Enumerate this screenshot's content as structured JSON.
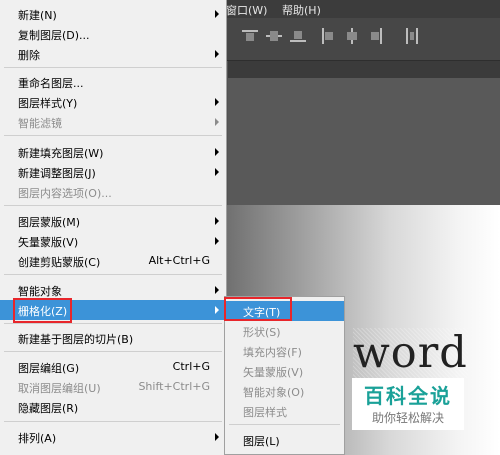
{
  "menubar": {
    "window": "窗口(W)",
    "help": "帮助(H)"
  },
  "menu": {
    "items": [
      {
        "label": "新建(N)",
        "shortcut": "",
        "submenu": true,
        "disabled": false
      },
      {
        "label": "复制图层(D)...",
        "shortcut": "",
        "submenu": false,
        "disabled": false
      },
      {
        "label": "删除",
        "shortcut": "",
        "submenu": true,
        "disabled": false
      },
      {
        "label": "重命名图层...",
        "shortcut": "",
        "submenu": false,
        "disabled": false
      },
      {
        "label": "图层样式(Y)",
        "shortcut": "",
        "submenu": true,
        "disabled": false
      },
      {
        "label": "智能滤镜",
        "shortcut": "",
        "submenu": true,
        "disabled": true
      },
      {
        "label": "新建填充图层(W)",
        "shortcut": "",
        "submenu": true,
        "disabled": false
      },
      {
        "label": "新建调整图层(J)",
        "shortcut": "",
        "submenu": true,
        "disabled": false
      },
      {
        "label": "图层内容选项(O)...",
        "shortcut": "",
        "submenu": false,
        "disabled": true
      },
      {
        "label": "图层蒙版(M)",
        "shortcut": "",
        "submenu": true,
        "disabled": false
      },
      {
        "label": "矢量蒙版(V)",
        "shortcut": "",
        "submenu": true,
        "disabled": false
      },
      {
        "label": "创建剪贴蒙版(C)",
        "shortcut": "Alt+Ctrl+G",
        "submenu": false,
        "disabled": false
      },
      {
        "label": "智能对象",
        "shortcut": "",
        "submenu": true,
        "disabled": false
      },
      {
        "label": "栅格化(Z)",
        "shortcut": "",
        "submenu": true,
        "disabled": false,
        "highlighted": true
      },
      {
        "label": "新建基于图层的切片(B)",
        "shortcut": "",
        "submenu": false,
        "disabled": false
      },
      {
        "label": "图层编组(G)",
        "shortcut": "Ctrl+G",
        "submenu": false,
        "disabled": false
      },
      {
        "label": "取消图层编组(U)",
        "shortcut": "Shift+Ctrl+G",
        "submenu": false,
        "disabled": true
      },
      {
        "label": "隐藏图层(R)",
        "shortcut": "",
        "submenu": false,
        "disabled": false
      },
      {
        "label": "排列(A)",
        "shortcut": "",
        "submenu": true,
        "disabled": false
      }
    ]
  },
  "submenu": {
    "items": [
      {
        "label": "文字(T)",
        "disabled": false,
        "highlighted": true
      },
      {
        "label": "形状(S)",
        "disabled": true
      },
      {
        "label": "填充内容(F)",
        "disabled": true
      },
      {
        "label": "矢量蒙版(V)",
        "disabled": true
      },
      {
        "label": "智能对象(O)",
        "disabled": true
      },
      {
        "label": "图层样式",
        "disabled": true
      },
      {
        "label": "图层(L)",
        "disabled": false
      }
    ]
  },
  "canvas": {
    "text": "word"
  },
  "watermark": {
    "title": "百科全说",
    "subtitle": "助你轻松解决"
  },
  "colors": {
    "highlight": "#3c93d8",
    "annotation": "#e8262b",
    "watermark": "#1aa198"
  }
}
